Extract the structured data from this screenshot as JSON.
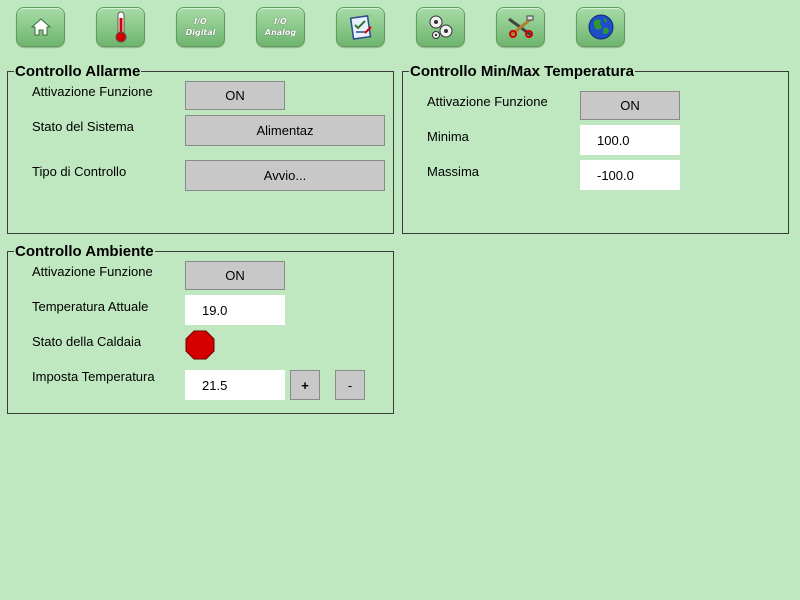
{
  "toolbar": {
    "home_icon": "home-icon",
    "thermometer_icon": "thermometer-icon",
    "io_digital_label_1": "I/O",
    "io_digital_label_2": "Digital",
    "io_analog_label_1": "I/O",
    "io_analog_label_2": "Analog",
    "clipboard_icon": "clipboard-icon",
    "gears_icon": "gears-icon",
    "tools_icon": "tools-icon",
    "globe_icon": "globe-icon"
  },
  "alarm_control": {
    "title": "Controllo Allarme",
    "function_label": "Attivazione Funzione",
    "function_value": "ON",
    "system_state_label": "Stato del Sistema",
    "system_state_value": "Alimentaz",
    "control_type_label": "Tipo di Controllo",
    "control_type_value": "Avvio..."
  },
  "minmax_control": {
    "title": "Controllo Min/Max Temperatura",
    "function_label": "Attivazione Funzione",
    "function_value": "ON",
    "min_label": "Minima",
    "min_value": "100.0",
    "max_label": "Massima",
    "max_value": "-100.0"
  },
  "ambient_control": {
    "title": "Controllo Ambiente",
    "function_label": "Attivazione Funzione",
    "function_value": "ON",
    "current_temp_label": "Temperatura Attuale",
    "current_temp_value": "19.0",
    "boiler_state_label": "Stato della Caldaia",
    "boiler_state_color": "#d40000",
    "set_temp_label": "Imposta Temperatura",
    "set_temp_value": "21.5",
    "plus_label": "+",
    "minus_label": "-"
  },
  "colors": {
    "background": "#c0e8c0",
    "button_gray": "#c8c8c8",
    "led_red": "#d40000"
  }
}
